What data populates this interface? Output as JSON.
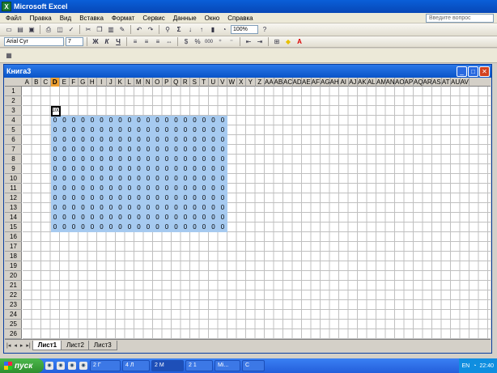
{
  "app": {
    "title": "Microsoft Excel",
    "icon": "excel-icon"
  },
  "menu": [
    "Файл",
    "Правка",
    "Вид",
    "Вставка",
    "Формат",
    "Сервис",
    "Данные",
    "Окно",
    "Справка"
  ],
  "ask": {
    "placeholder": "Введите вопрос"
  },
  "toolbar": {
    "zoom": "100%",
    "font": "Arial Cyr",
    "size": "7",
    "bold": "Ж",
    "italic": "К",
    "underline": "Ч",
    "sum": "Σ",
    "percent": "%",
    "thousands": "000"
  },
  "workbook": {
    "title": "Книга3"
  },
  "columns": [
    "A",
    "B",
    "C",
    "D",
    "E",
    "F",
    "G",
    "H",
    "I",
    "J",
    "K",
    "L",
    "M",
    "N",
    "O",
    "P",
    "Q",
    "R",
    "S",
    "T",
    "U",
    "V",
    "W",
    "X",
    "Y",
    "Z",
    "AA",
    "AB",
    "AC",
    "AD",
    "AE",
    "AF",
    "AG",
    "AH",
    "AI",
    "AJ",
    "AK",
    "AL",
    "AM",
    "AN",
    "AO",
    "AP",
    "AQ",
    "AR",
    "AS",
    "AT",
    "AU",
    "AV"
  ],
  "rows": [
    "1",
    "2",
    "3",
    "4",
    "5",
    "6",
    "7",
    "8",
    "9",
    "10",
    "11",
    "12",
    "13",
    "14",
    "15",
    "16",
    "17",
    "18",
    "19",
    "20",
    "21",
    "22",
    "23",
    "24",
    "25",
    "26"
  ],
  "active_cell": {
    "value": "100"
  },
  "cell_value": "0",
  "sheets": [
    "Лист1",
    "Лист2",
    "Лист3"
  ],
  "taskbar": {
    "start": "пуск",
    "tasks": [
      "2 Г",
      "4 Л",
      "2 М",
      "2 1",
      "Mi...",
      "C"
    ],
    "lang": "EN",
    "clock": "22:40"
  }
}
